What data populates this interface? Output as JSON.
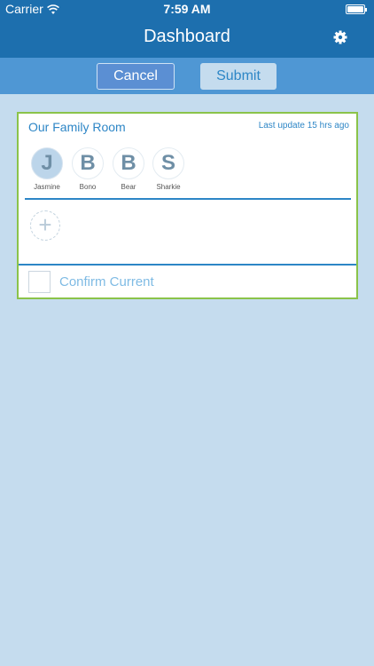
{
  "status_bar": {
    "carrier": "Carrier",
    "time": "7:59 AM",
    "wifi_icon": "wifi-icon",
    "battery_icon": "battery-icon",
    "battery_level": 1.0
  },
  "nav": {
    "title": "Dashboard",
    "settings_icon": "gear-icon"
  },
  "actions": {
    "cancel_label": "Cancel",
    "submit_label": "Submit"
  },
  "room": {
    "title": "Our Family Room",
    "last_update": "Last update 15 hrs ago",
    "members": [
      {
        "initial": "J",
        "name": "Jasmine",
        "selected": true
      },
      {
        "initial": "B",
        "name": "Bono",
        "selected": false
      },
      {
        "initial": "B",
        "name": "Bear",
        "selected": false
      },
      {
        "initial": "S",
        "name": "Sharkie",
        "selected": false
      }
    ],
    "add_icon": "plus-icon",
    "add_symbol": "+",
    "confirm_label": "Confirm Current"
  },
  "colors": {
    "header": "#1d6fae",
    "action_bar": "#4f97d4",
    "background": "#c5dcee",
    "card_border": "#8bc34a",
    "accent": "#2d86c6"
  }
}
